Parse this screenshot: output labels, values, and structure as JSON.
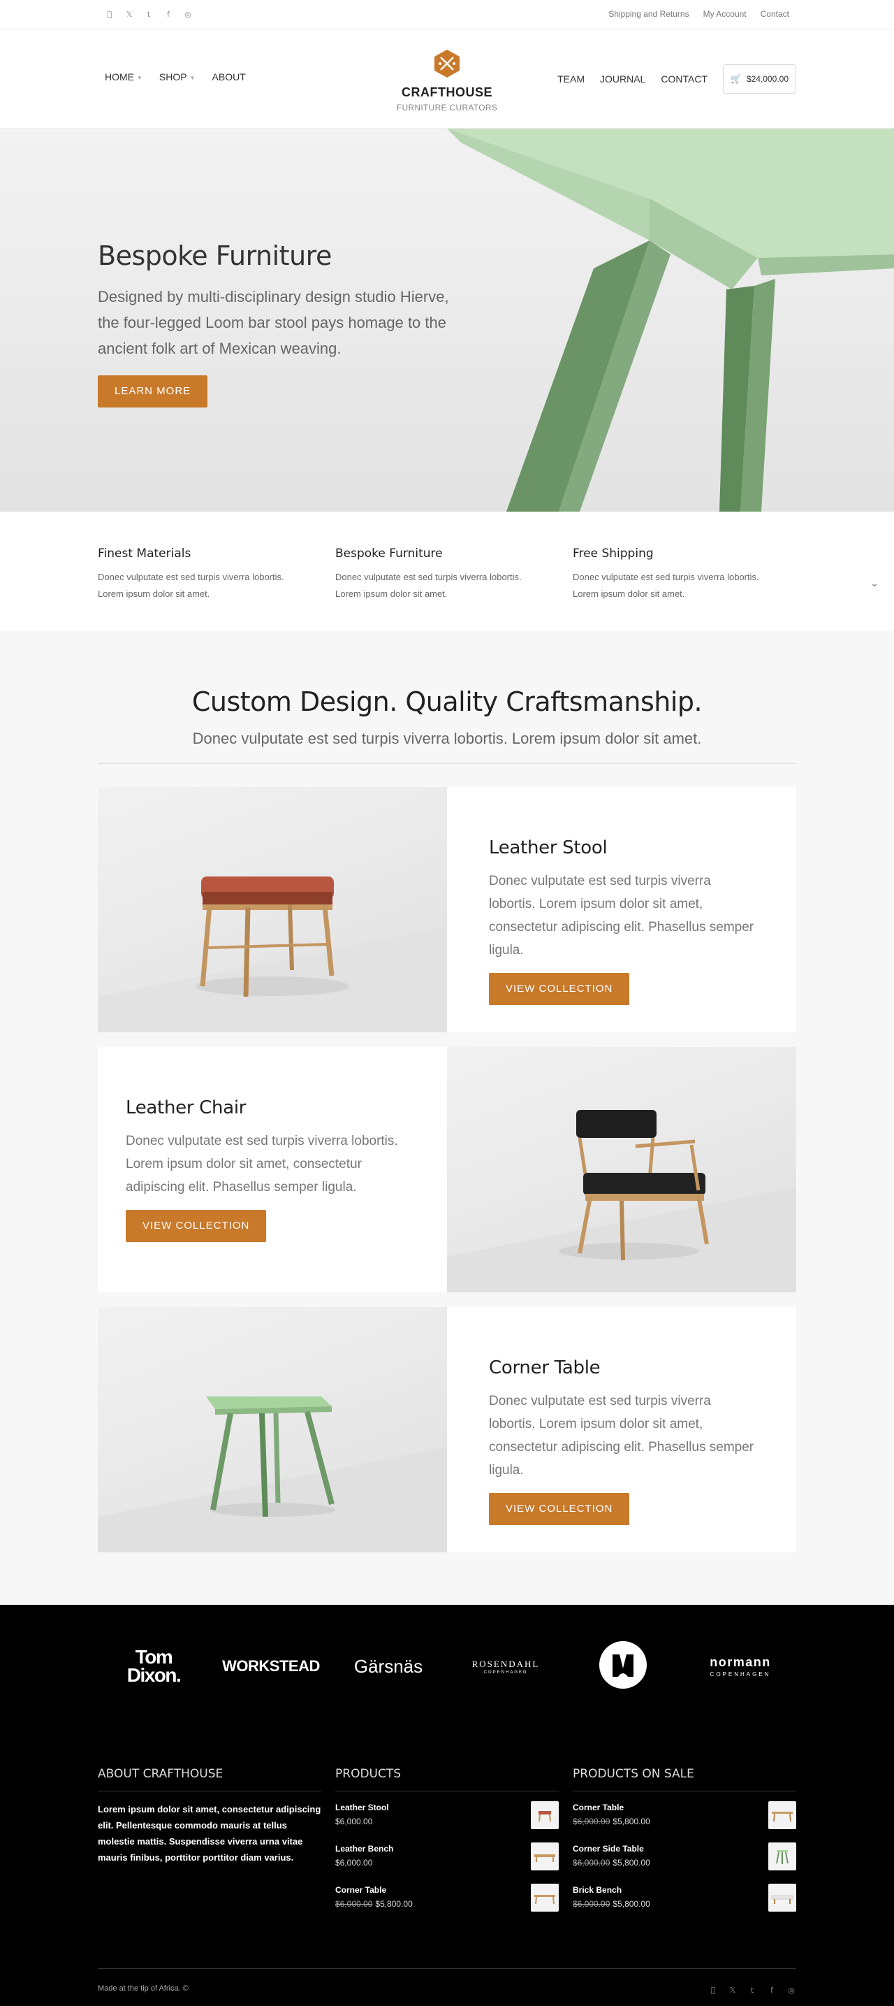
{
  "topbar": {
    "social_icons": [
      "apple-icon",
      "twitter-icon",
      "tumblr-icon",
      "facebook-icon",
      "dribbble-icon"
    ],
    "links": [
      "Shipping and Returns",
      "My Account",
      "Contact"
    ]
  },
  "header": {
    "nav_left": [
      {
        "label": "HOME",
        "has_dropdown": true
      },
      {
        "label": "SHOP",
        "has_dropdown": true
      },
      {
        "label": "ABOUT",
        "has_dropdown": false
      }
    ],
    "logo_name": "CRAFTHOUSE",
    "logo_tagline": "FURNITURE CURATORS",
    "nav_right": [
      "TEAM",
      "JOURNAL",
      "CONTACT"
    ],
    "cart_total": "$24,000.00"
  },
  "hero": {
    "title": "Bespoke Furniture",
    "text": "Designed by multi-disciplinary design studio Hierve, the four-legged Loom bar stool pays homage to the ancient folk art of Mexican weaving.",
    "button": "LEARN MORE"
  },
  "features": [
    {
      "title": "Finest Materials",
      "text": "Donec vulputate est sed turpis viverra lobortis. Lorem ipsum dolor sit amet."
    },
    {
      "title": "Bespoke Furniture",
      "text": "Donec vulputate est sed turpis viverra lobortis. Lorem ipsum dolor sit amet."
    },
    {
      "title": "Free Shipping",
      "text": "Donec vulputate est sed turpis viverra lobortis. Lorem ipsum dolor sit amet."
    }
  ],
  "collections": {
    "title": "Custom Design. Quality Craftsmanship.",
    "subtitle": "Donec vulputate est sed turpis viverra lobortis. Lorem ipsum dolor sit amet.",
    "items": [
      {
        "title": "Leather Stool",
        "text": "Donec vulputate est sed turpis viverra lobortis. Lorem ipsum dolor sit amet, consectetur adipiscing elit. Phasellus semper ligula.",
        "button": "VIEW COLLECTION"
      },
      {
        "title": "Leather Chair",
        "text": "Donec vulputate est sed turpis viverra lobortis. Lorem ipsum dolor sit amet, consectetur adipiscing elit. Phasellus semper ligula.",
        "button": "VIEW COLLECTION"
      },
      {
        "title": "Corner Table",
        "text": "Donec vulputate est sed turpis viverra lobortis. Lorem ipsum dolor sit amet, consectetur adipiscing elit. Phasellus semper ligula.",
        "button": "VIEW COLLECTION"
      }
    ]
  },
  "brands": [
    "Tom Dixon.",
    "WORKSTEAD",
    "Gärsnäs",
    "ROSENDAHL",
    "COPENHAGEN",
    "normann",
    "COPENHAGEN"
  ],
  "footer": {
    "about_title": "ABOUT CRAFTHOUSE",
    "about_text": "Lorem ipsum dolor sit amet, consectetur adipiscing elit. Pellentesque commodo mauris at tellus molestie mattis. Suspendisse viverra urna vitae mauris finibus, porttitor porttitor diam varius.",
    "products_title": "PRODUCTS",
    "products": [
      {
        "name": "Leather Stool",
        "price": "$6,000.00",
        "old_price": ""
      },
      {
        "name": "Leather Bench",
        "price": "$6,000.00",
        "old_price": ""
      },
      {
        "name": "Corner Table",
        "price": "$5,800.00",
        "old_price": "$6,000.00"
      }
    ],
    "sale_title": "PRODUCTS ON SALE",
    "sale": [
      {
        "name": "Corner Table",
        "price": "$5,800.00",
        "old_price": "$6,000.00"
      },
      {
        "name": "Corner Side Table",
        "price": "$5,800.00",
        "old_price": "$6,000.00"
      },
      {
        "name": "Brick Bench",
        "price": "$5,800.00",
        "old_price": "$6,000.00"
      }
    ],
    "credit": "Made at the tip of Africa. ©",
    "social_icons": [
      "apple-icon",
      "twitter-icon",
      "tumblr-icon",
      "facebook-icon",
      "dribbble-icon"
    ]
  },
  "colors": {
    "accent": "#c8792a",
    "green": "#7fa77a",
    "footer_bg": "#000000"
  }
}
